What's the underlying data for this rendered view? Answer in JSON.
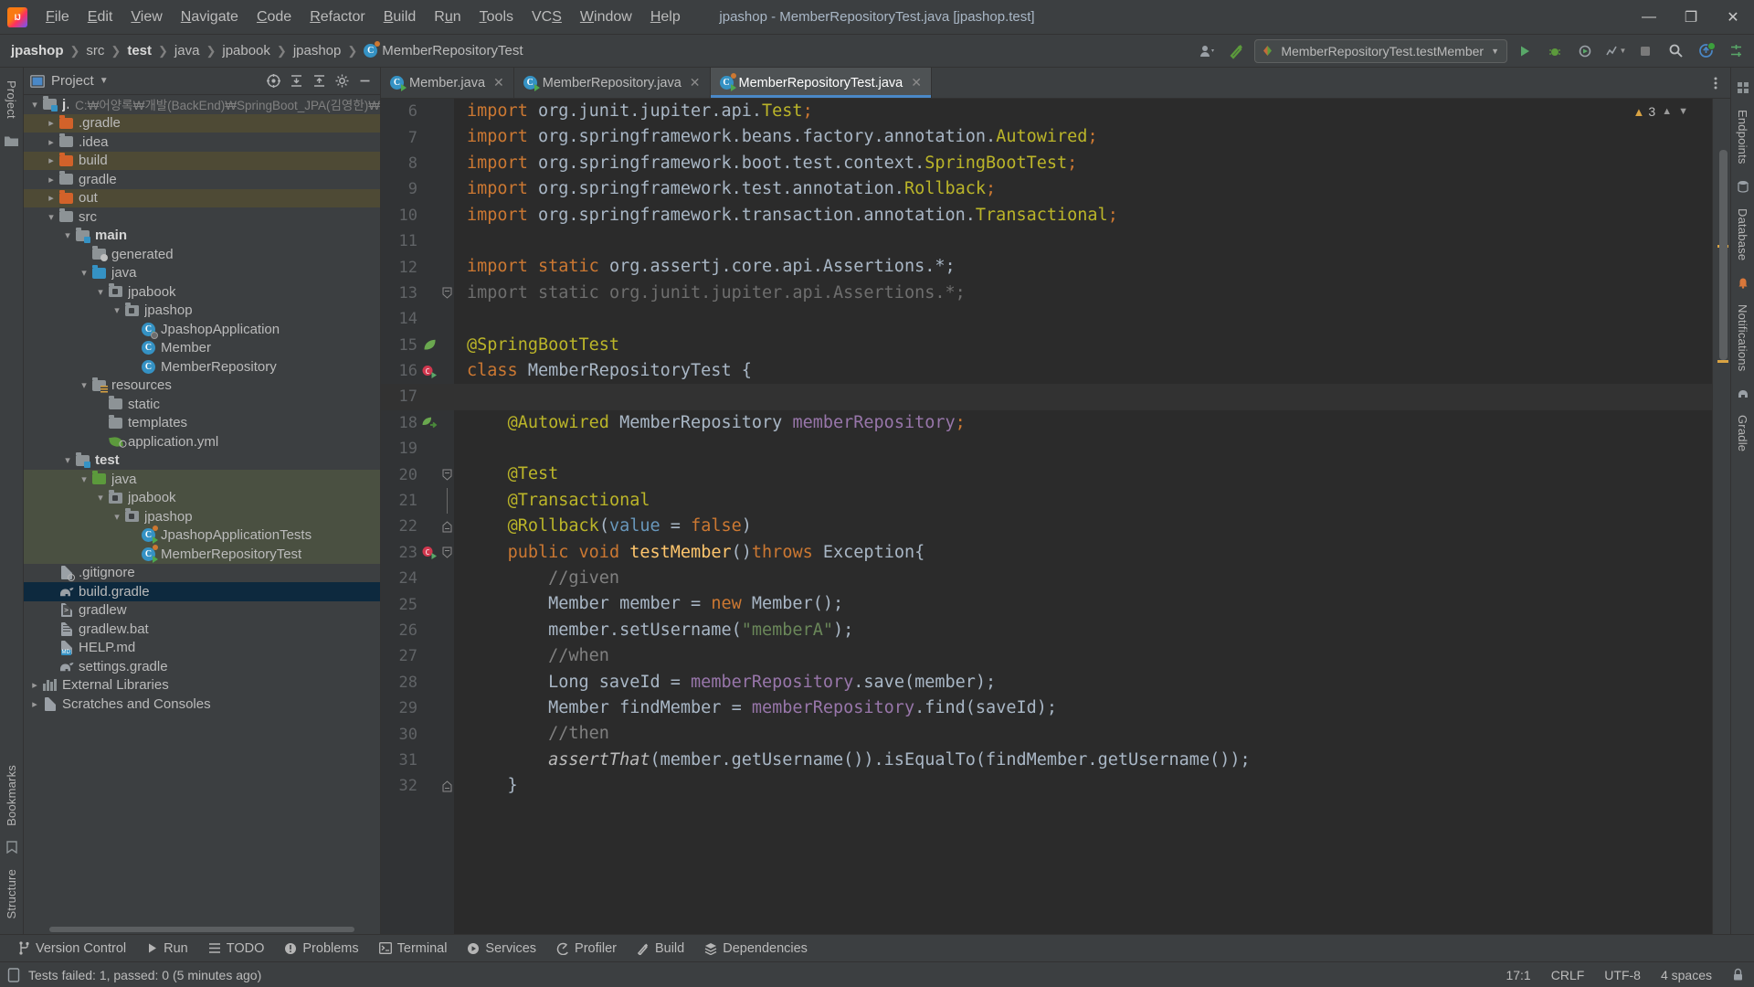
{
  "window": {
    "title": "jpashop - MemberRepositoryTest.java [jpashop.test]",
    "logo": "intellij-idea-logo",
    "minimize": "—",
    "maximize": "❐",
    "close": "✕"
  },
  "menubar": {
    "items": [
      "File",
      "Edit",
      "View",
      "Navigate",
      "Code",
      "Refactor",
      "Build",
      "Run",
      "Tools",
      "VCS",
      "Window",
      "Help"
    ]
  },
  "breadcrumb": {
    "items": [
      {
        "label": "jpashop",
        "bold": true,
        "icon": ""
      },
      {
        "label": "src",
        "bold": false,
        "icon": ""
      },
      {
        "label": "test",
        "bold": true,
        "icon": ""
      },
      {
        "label": "java",
        "bold": false,
        "icon": ""
      },
      {
        "label": "jpabook",
        "bold": false,
        "icon": ""
      },
      {
        "label": "jpashop",
        "bold": false,
        "icon": ""
      },
      {
        "label": "MemberRepositoryTest",
        "bold": false,
        "icon": "class-icon"
      }
    ],
    "separator": "❯"
  },
  "toolbar": {
    "account_icon": "user-account-icon",
    "build_icon": "hammer-build-icon",
    "run_config": "MemberRepositoryTest.testMember",
    "run_config_icon": "junit-run-config-icon",
    "run_icon": "run-icon",
    "debug_icon": "debug-icon",
    "coverage_icon": "run-with-coverage-icon",
    "profile_icon": "profiler-icon",
    "stop_icon": "stop-icon",
    "search_icon": "search-everywhere-icon",
    "update_icon": "ide-update-icon",
    "settings_icon": "settings-icon"
  },
  "project_panel": {
    "title": "Project",
    "dropdown_caret": "▾",
    "tools": [
      "select-opened-file-icon",
      "expand-all-icon",
      "collapse-all-icon",
      "settings-icon",
      "hide-icon"
    ],
    "tree": [
      {
        "label": "jpashop",
        "path": "C:₩어양록₩개발(BackEnd)₩SpringBoot_JPA(김영한)₩",
        "indent": 0,
        "arrow": "down",
        "icon": "module-folder",
        "bold": true,
        "tint": "none"
      },
      {
        "label": ".gradle",
        "indent": 1,
        "arrow": "right",
        "icon": "folder-orange",
        "bold": false,
        "tint": "excluded"
      },
      {
        "label": ".idea",
        "indent": 1,
        "arrow": "right",
        "icon": "folder-gray",
        "bold": false,
        "tint": "none"
      },
      {
        "label": "build",
        "indent": 1,
        "arrow": "right",
        "icon": "folder-orange",
        "bold": false,
        "tint": "excluded"
      },
      {
        "label": "gradle",
        "indent": 1,
        "arrow": "right",
        "icon": "folder-gray",
        "bold": false,
        "tint": "none"
      },
      {
        "label": "out",
        "indent": 1,
        "arrow": "right",
        "icon": "folder-orange",
        "bold": false,
        "tint": "excluded"
      },
      {
        "label": "src",
        "indent": 1,
        "arrow": "down",
        "icon": "folder-gray",
        "bold": false,
        "tint": "none"
      },
      {
        "label": "main",
        "indent": 2,
        "arrow": "down",
        "icon": "source-root-folder",
        "bold": true,
        "tint": "none"
      },
      {
        "label": "generated",
        "indent": 3,
        "arrow": "none",
        "icon": "folder-generated",
        "bold": false,
        "tint": "none"
      },
      {
        "label": "java",
        "indent": 3,
        "arrow": "down",
        "icon": "folder-blue",
        "bold": false,
        "tint": "none"
      },
      {
        "label": "jpabook",
        "indent": 4,
        "arrow": "down",
        "icon": "package-icon",
        "bold": false,
        "tint": "none"
      },
      {
        "label": "jpashop",
        "indent": 5,
        "arrow": "down",
        "icon": "package-icon",
        "bold": false,
        "tint": "none"
      },
      {
        "label": "JpashopApplication",
        "indent": 6,
        "arrow": "none",
        "icon": "spring-class-icon",
        "bold": false,
        "tint": "none"
      },
      {
        "label": "Member",
        "indent": 6,
        "arrow": "none",
        "icon": "class-icon",
        "bold": false,
        "tint": "none"
      },
      {
        "label": "MemberRepository",
        "indent": 6,
        "arrow": "none",
        "icon": "class-icon",
        "bold": false,
        "tint": "none"
      },
      {
        "label": "resources",
        "indent": 3,
        "arrow": "down",
        "icon": "resources-root-folder",
        "bold": false,
        "tint": "none"
      },
      {
        "label": "static",
        "indent": 4,
        "arrow": "none",
        "icon": "folder-gray",
        "bold": false,
        "tint": "none"
      },
      {
        "label": "templates",
        "indent": 4,
        "arrow": "none",
        "icon": "folder-gray",
        "bold": false,
        "tint": "none"
      },
      {
        "label": "application.yml",
        "indent": 4,
        "arrow": "none",
        "icon": "spring-yaml-icon",
        "bold": false,
        "tint": "none"
      },
      {
        "label": "test",
        "indent": 2,
        "arrow": "down",
        "icon": "test-root-folder",
        "bold": true,
        "tint": "none"
      },
      {
        "label": "java",
        "indent": 3,
        "arrow": "down",
        "icon": "folder-green",
        "bold": false,
        "tint": "test"
      },
      {
        "label": "jpabook",
        "indent": 4,
        "arrow": "down",
        "icon": "package-icon",
        "bold": false,
        "tint": "test"
      },
      {
        "label": "jpashop",
        "indent": 5,
        "arrow": "down",
        "icon": "package-icon",
        "bold": false,
        "tint": "test"
      },
      {
        "label": "JpashopApplicationTests",
        "indent": 6,
        "arrow": "none",
        "icon": "test-class-icon",
        "bold": false,
        "tint": "test"
      },
      {
        "label": "MemberRepositoryTest",
        "indent": 6,
        "arrow": "none",
        "icon": "test-class-icon",
        "bold": false,
        "tint": "test"
      },
      {
        "label": ".gitignore",
        "indent": 1,
        "arrow": "none",
        "icon": "gitignore-icon",
        "bold": false,
        "tint": "none"
      },
      {
        "label": "build.gradle",
        "indent": 1,
        "arrow": "none",
        "icon": "gradle-icon",
        "bold": false,
        "tint": "selected"
      },
      {
        "label": "gradlew",
        "indent": 1,
        "arrow": "none",
        "icon": "shell-script-icon",
        "bold": false,
        "tint": "none"
      },
      {
        "label": "gradlew.bat",
        "indent": 1,
        "arrow": "none",
        "icon": "batch-file-icon",
        "bold": false,
        "tint": "none"
      },
      {
        "label": "HELP.md",
        "indent": 1,
        "arrow": "none",
        "icon": "markdown-icon",
        "bold": false,
        "tint": "none"
      },
      {
        "label": "settings.gradle",
        "indent": 1,
        "arrow": "none",
        "icon": "gradle-icon",
        "bold": false,
        "tint": "none"
      },
      {
        "label": "External Libraries",
        "indent": 0,
        "arrow": "right",
        "icon": "libraries-icon",
        "bold": false,
        "tint": "none"
      },
      {
        "label": "Scratches and Consoles",
        "indent": 0,
        "arrow": "right",
        "icon": "scratches-icon",
        "bold": false,
        "tint": "none"
      }
    ]
  },
  "left_strip": {
    "labels": [
      "Project",
      "Bookmarks",
      "Structure"
    ],
    "icons": [
      "project-icon",
      "bookmarks-icon",
      "structure-icon"
    ]
  },
  "right_strip": {
    "labels": [
      "Endpoints",
      "Database",
      "Notifications",
      "Gradle"
    ]
  },
  "editor": {
    "tabs": [
      {
        "label": "Member.java",
        "icon": "java-class-icon",
        "active": false,
        "close": "✕"
      },
      {
        "label": "MemberRepository.java",
        "icon": "java-class-icon",
        "active": false,
        "close": "✕"
      },
      {
        "label": "MemberRepositoryTest.java",
        "icon": "java-test-class-icon",
        "active": true,
        "close": "✕"
      }
    ],
    "more_icon": "more-options-icon",
    "warning_count": "3",
    "warning_icon": "warning-triangle-icon",
    "inspect_up": "⌃",
    "inspect_down": "⌄",
    "caret_line": 17,
    "lines": [
      {
        "n": 6,
        "fold": "none",
        "gutter": "none",
        "tokens": [
          {
            "t": "import ",
            "c": "kw"
          },
          {
            "t": "org.junit.jupiter.api.",
            "c": "pln"
          },
          {
            "t": "Test",
            "c": "ann"
          },
          {
            "t": ";",
            "c": "semi"
          }
        ]
      },
      {
        "n": 7,
        "fold": "none",
        "gutter": "none",
        "tokens": [
          {
            "t": "import ",
            "c": "kw"
          },
          {
            "t": "org.springframework.beans.factory.annotation.",
            "c": "pln"
          },
          {
            "t": "Autowired",
            "c": "ann"
          },
          {
            "t": ";",
            "c": "semi"
          }
        ]
      },
      {
        "n": 8,
        "fold": "none",
        "gutter": "none",
        "tokens": [
          {
            "t": "import ",
            "c": "kw"
          },
          {
            "t": "org.springframework.boot.test.context.",
            "c": "pln"
          },
          {
            "t": "SpringBootTest",
            "c": "ann"
          },
          {
            "t": ";",
            "c": "semi"
          }
        ]
      },
      {
        "n": 9,
        "fold": "none",
        "gutter": "none",
        "tokens": [
          {
            "t": "import ",
            "c": "kw"
          },
          {
            "t": "org.springframework.test.annotation.",
            "c": "pln"
          },
          {
            "t": "Rollback",
            "c": "ann"
          },
          {
            "t": ";",
            "c": "semi"
          }
        ]
      },
      {
        "n": 10,
        "fold": "none",
        "gutter": "none",
        "tokens": [
          {
            "t": "import ",
            "c": "kw"
          },
          {
            "t": "org.springframework.transaction.annotation.",
            "c": "pln"
          },
          {
            "t": "Transactional",
            "c": "ann"
          },
          {
            "t": ";",
            "c": "semi"
          }
        ]
      },
      {
        "n": 11,
        "fold": "none",
        "gutter": "none",
        "tokens": []
      },
      {
        "n": 12,
        "fold": "none",
        "gutter": "none",
        "tokens": [
          {
            "t": "import ",
            "c": "kw"
          },
          {
            "t": "static ",
            "c": "kw"
          },
          {
            "t": "org.assertj.core.api.Assertions.*;",
            "c": "pln"
          }
        ]
      },
      {
        "n": 13,
        "fold": "collapse-top",
        "gutter": "none",
        "tokens": [
          {
            "t": "import ",
            "c": "dim"
          },
          {
            "t": "static ",
            "c": "dim"
          },
          {
            "t": "org.junit.jupiter.api.Assertions.*;",
            "c": "dim"
          }
        ]
      },
      {
        "n": 14,
        "fold": "none",
        "gutter": "none",
        "tokens": []
      },
      {
        "n": 15,
        "fold": "none",
        "gutter": "spring-leaf",
        "tokens": [
          {
            "t": "@SpringBootTest",
            "c": "ann"
          }
        ]
      },
      {
        "n": 16,
        "fold": "none",
        "gutter": "run-test-class",
        "tokens": [
          {
            "t": "class ",
            "c": "kw"
          },
          {
            "t": "MemberRepositoryTest ",
            "c": "pln"
          },
          {
            "t": "{",
            "c": "pln"
          }
        ]
      },
      {
        "n": 17,
        "fold": "none",
        "gutter": "none",
        "tokens": []
      },
      {
        "n": 18,
        "fold": "none",
        "gutter": "spring-bean",
        "tokens": [
          {
            "t": "    ",
            "c": "pln"
          },
          {
            "t": "@Autowired",
            "c": "ann"
          },
          {
            "t": " MemberRepository ",
            "c": "pln"
          },
          {
            "t": "memberRepository",
            "c": "fld"
          },
          {
            "t": ";",
            "c": "semi"
          }
        ]
      },
      {
        "n": 19,
        "fold": "none",
        "gutter": "none",
        "tokens": []
      },
      {
        "n": 20,
        "fold": "expand",
        "gutter": "none",
        "tokens": [
          {
            "t": "    ",
            "c": "pln"
          },
          {
            "t": "@Test",
            "c": "ann"
          }
        ]
      },
      {
        "n": 21,
        "fold": "line",
        "gutter": "none",
        "tokens": [
          {
            "t": "    ",
            "c": "pln"
          },
          {
            "t": "@Transactional",
            "c": "ann"
          }
        ]
      },
      {
        "n": 22,
        "fold": "collapse",
        "gutter": "none",
        "tokens": [
          {
            "t": "    ",
            "c": "pln"
          },
          {
            "t": "@Rollback",
            "c": "ann"
          },
          {
            "t": "(",
            "c": "pln"
          },
          {
            "t": "value",
            "c": "num"
          },
          {
            "t": " = ",
            "c": "pln"
          },
          {
            "t": "false",
            "c": "kw"
          },
          {
            "t": ")",
            "c": "pln"
          }
        ]
      },
      {
        "n": 23,
        "fold": "expand",
        "gutter": "run-test-method",
        "tokens": [
          {
            "t": "    ",
            "c": "pln"
          },
          {
            "t": "public ",
            "c": "kw"
          },
          {
            "t": "void ",
            "c": "kw"
          },
          {
            "t": "testMember",
            "c": "mth"
          },
          {
            "t": "()",
            "c": "pln"
          },
          {
            "t": "throws ",
            "c": "kw"
          },
          {
            "t": "Exception",
            "c": "typ"
          },
          {
            "t": "{",
            "c": "pln"
          }
        ]
      },
      {
        "n": 24,
        "fold": "none",
        "gutter": "none",
        "tokens": [
          {
            "t": "        ",
            "c": "pln"
          },
          {
            "t": "//given",
            "c": "cmt"
          }
        ]
      },
      {
        "n": 25,
        "fold": "none",
        "gutter": "none",
        "tokens": [
          {
            "t": "        Member member = ",
            "c": "pln"
          },
          {
            "t": "new ",
            "c": "kw"
          },
          {
            "t": "Member();",
            "c": "pln"
          }
        ]
      },
      {
        "n": 26,
        "fold": "none",
        "gutter": "none",
        "tokens": [
          {
            "t": "        member.setUsername(",
            "c": "pln"
          },
          {
            "t": "\"memberA\"",
            "c": "str"
          },
          {
            "t": ");",
            "c": "pln"
          }
        ]
      },
      {
        "n": 27,
        "fold": "none",
        "gutter": "none",
        "tokens": [
          {
            "t": "        ",
            "c": "pln"
          },
          {
            "t": "//when",
            "c": "cmt"
          }
        ]
      },
      {
        "n": 28,
        "fold": "none",
        "gutter": "none",
        "tokens": [
          {
            "t": "        Long saveId = ",
            "c": "pln"
          },
          {
            "t": "memberRepository",
            "c": "fld"
          },
          {
            "t": ".save(member);",
            "c": "pln"
          }
        ]
      },
      {
        "n": 29,
        "fold": "none",
        "gutter": "none",
        "tokens": [
          {
            "t": "        Member findMember = ",
            "c": "pln"
          },
          {
            "t": "memberRepository",
            "c": "fld"
          },
          {
            "t": ".find(saveId);",
            "c": "pln"
          }
        ]
      },
      {
        "n": 30,
        "fold": "none",
        "gutter": "none",
        "tokens": [
          {
            "t": "        ",
            "c": "pln"
          },
          {
            "t": "//then",
            "c": "cmt"
          }
        ]
      },
      {
        "n": 31,
        "fold": "none",
        "gutter": "none",
        "tokens": [
          {
            "t": "        ",
            "c": "pln"
          },
          {
            "t": "assertThat",
            "c": "ital"
          },
          {
            "t": "(member.getUsername()).isEqualTo(findMember.getUsername());",
            "c": "pln"
          }
        ]
      },
      {
        "n": 32,
        "fold": "collapse-end",
        "gutter": "none",
        "tokens": [
          {
            "t": "    }",
            "c": "pln"
          }
        ]
      }
    ]
  },
  "bottom_bar": {
    "items": [
      {
        "label": "Version Control",
        "icon": "branch-icon"
      },
      {
        "label": "Run",
        "icon": "run-icon"
      },
      {
        "label": "TODO",
        "icon": "todo-list-icon"
      },
      {
        "label": "Problems",
        "icon": "problems-icon"
      },
      {
        "label": "Terminal",
        "icon": "terminal-icon"
      },
      {
        "label": "Services",
        "icon": "services-icon"
      },
      {
        "label": "Profiler",
        "icon": "profiler-icon"
      },
      {
        "label": "Build",
        "icon": "hammer-build-icon"
      },
      {
        "label": "Dependencies",
        "icon": "dependencies-icon"
      }
    ]
  },
  "status_bar": {
    "message_icon": "event-log-icon",
    "message": "Tests failed: 1, passed: 0 (5 minutes ago)",
    "caret_position": "17:1",
    "line_separator": "CRLF",
    "encoding": "UTF-8",
    "indent": "4 spaces",
    "lock_icon": "read-only-toggle-icon"
  },
  "colors": {
    "accent_blue": "#4a88c7",
    "selection": "#0d293e",
    "test_root": "#4a5041",
    "excluded": "#4e4a35",
    "editor_bg": "#2b2b2b",
    "panel_bg": "#3c3f41",
    "warning": "#d9a343"
  }
}
